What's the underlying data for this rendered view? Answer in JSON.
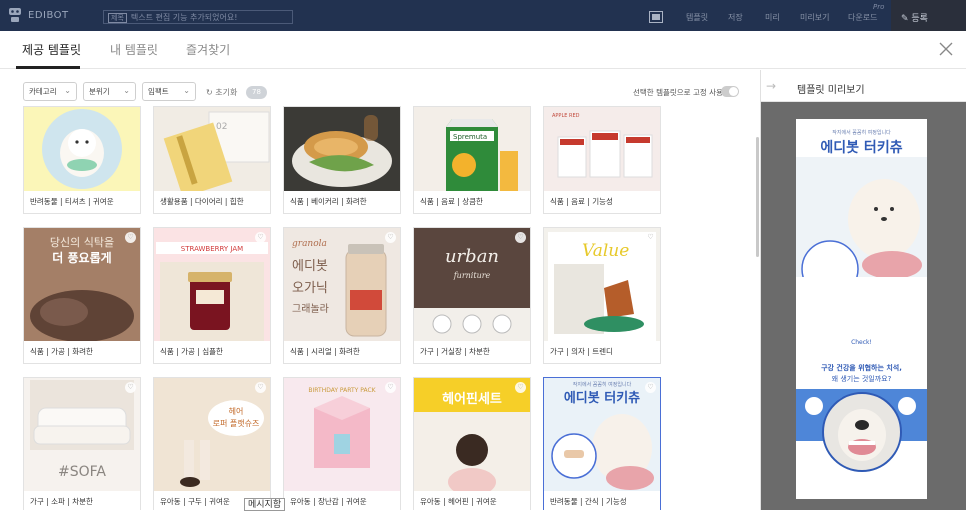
{
  "app": {
    "brand": "EDIBOT",
    "crumb_tag": "제목",
    "crumb_text": "텍스트 편집 기능 추가되었어요!",
    "menu": [
      "템플릿",
      "저장",
      "미리",
      "미리보기",
      "다운로드"
    ],
    "upgrade_label": "Pro",
    "logout_label": "등록"
  },
  "tabs": [
    "제공 템플릿",
    "내 템플릿",
    "즐겨찾기"
  ],
  "filters": {
    "category": "카테고리",
    "mood": "분위기",
    "impact": "임팩트",
    "reset": "초기화",
    "count": "78",
    "fix_label": "선택한 템플릿으로 고정 사용"
  },
  "cards": [
    {
      "caption": "반려동물 | 티셔츠 | 귀여운",
      "heart": false
    },
    {
      "caption": "생활용품 | 다이어리 | 힙한",
      "heart": false
    },
    {
      "caption": "식품 | 베이커리 | 화려한",
      "heart": false
    },
    {
      "caption": "식품 | 음료 | 상큼한",
      "heart": false
    },
    {
      "caption": "식품 | 음료 | 기능성",
      "heart": false
    },
    {
      "caption": "식품 | 가공 | 화려한",
      "heart": true,
      "title": "당신의 식탁을\n더 풍요롭게"
    },
    {
      "caption": "식품 | 가공 | 심플한",
      "heart": true,
      "title": "STRAWBERRY JAM"
    },
    {
      "caption": "식품 | 시리얼 | 화려한",
      "heart": true,
      "title": "에디봇\n오가닉\n그래놀라"
    },
    {
      "caption": "가구 | 거실장 | 차분한",
      "heart": true,
      "title": "urban"
    },
    {
      "caption": "가구 | 의자 | 트렌디",
      "heart": true,
      "title": "Value"
    },
    {
      "caption": "가구 | 소파 | 차분한",
      "heart": true,
      "title": "#SOFA"
    },
    {
      "caption": "유아동 | 구두 | 귀여운",
      "heart": true,
      "title": "헤어\n로퍼 플랫슈즈"
    },
    {
      "caption": "유아동 | 장난감 | 귀여운",
      "heart": true,
      "title": "BIRTHDAY PARTY PACK"
    },
    {
      "caption": "유아동 | 헤어핀 | 귀여운",
      "heart": true,
      "title": "헤어핀세트"
    },
    {
      "caption": "반려동물 | 간식 | 기능성",
      "heart": true,
      "title": "에디봇 터키츄"
    }
  ],
  "tooltip": "메시지함",
  "preview": {
    "title": "템플릿 미리보기",
    "poster_small": "작지에서 꼼꼼히 여정입니다",
    "poster_title": "에디봇 터키츄",
    "check_label": "Check!",
    "headline": "구강 건강을 위협하는 치석,",
    "sub": "왜 생기는 것일까요?"
  },
  "colors": {
    "appbar": "#223250",
    "accent": "#4a6fd6",
    "poster_blue": "#2f5ab5"
  }
}
